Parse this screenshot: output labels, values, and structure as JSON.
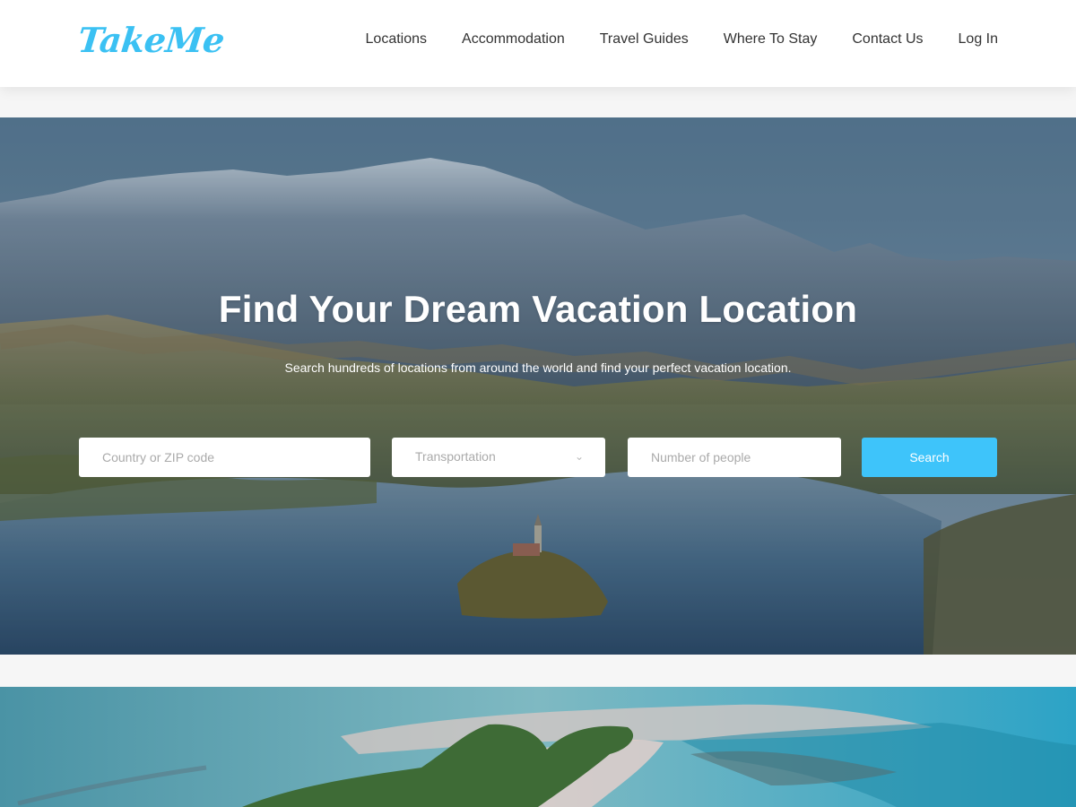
{
  "header": {
    "logo": "TakeMe",
    "nav": [
      {
        "label": "Locations"
      },
      {
        "label": "Accommodation"
      },
      {
        "label": "Travel Guides"
      },
      {
        "label": "Where To Stay"
      },
      {
        "label": "Contact Us"
      },
      {
        "label": "Log In"
      }
    ]
  },
  "hero": {
    "title": "Find Your Dream Vacation Location",
    "subtitle": "Search hundreds of locations from around the world and find your perfect vacation location.",
    "search": {
      "location_placeholder": "Country or ZIP code",
      "transportation_selected": "Transportation",
      "people_placeholder": "Number of people",
      "search_label": "Search"
    }
  },
  "colors": {
    "brand": "#3bc1f3",
    "search_button": "#3ec4fa",
    "nav_text": "#333333"
  }
}
